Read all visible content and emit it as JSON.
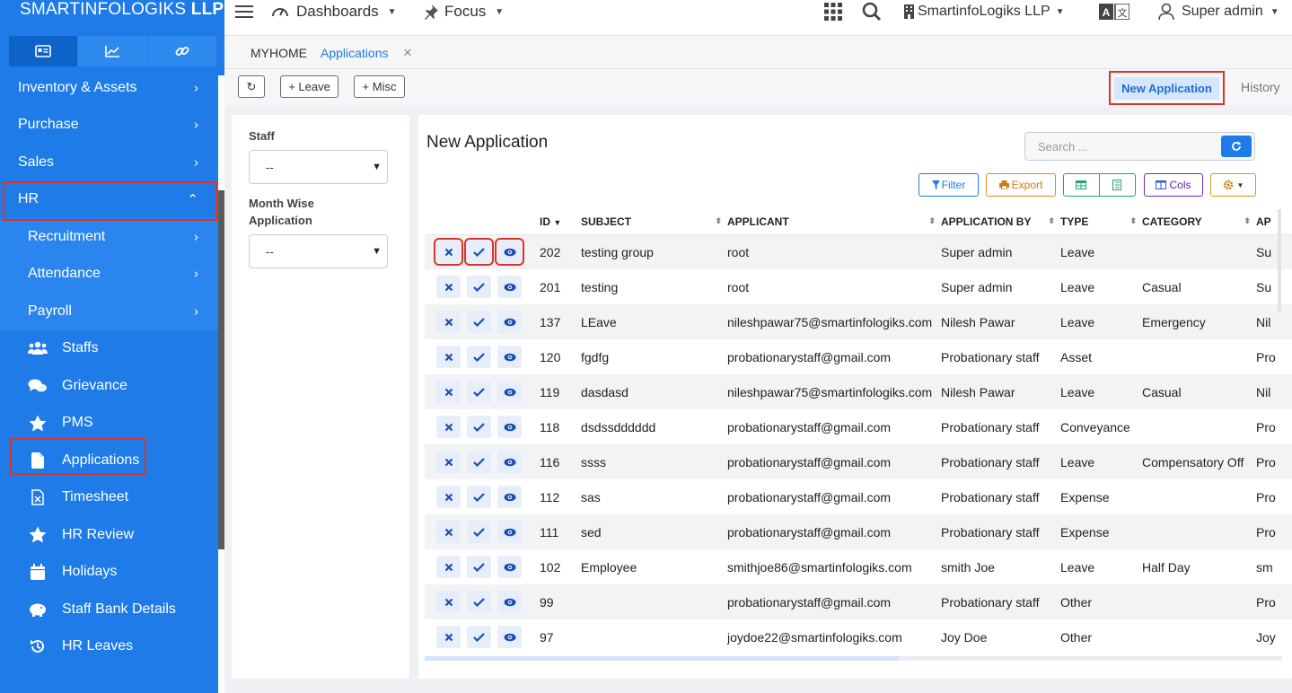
{
  "brand": {
    "name_light": "SMARTINFOLOGIKS",
    "name_bold": "LLP"
  },
  "sidebar": {
    "tabs": [
      {
        "icon": "id-card-icon"
      },
      {
        "icon": "chart-line-icon"
      },
      {
        "icon": "link-icon"
      }
    ],
    "items": [
      {
        "label": "Inventory & Assets",
        "level": 0,
        "chevron": "›"
      },
      {
        "label": "Purchase",
        "level": 0,
        "chevron": "›"
      },
      {
        "label": "Sales",
        "level": 0,
        "chevron": "›"
      },
      {
        "label": "HR",
        "level": 0,
        "chevron": "⌃"
      },
      {
        "label": "Recruitment",
        "level": 1,
        "chevron": "›"
      },
      {
        "label": "Attendance",
        "level": 1,
        "chevron": "›"
      },
      {
        "label": "Payroll",
        "level": 1,
        "chevron": "›"
      },
      {
        "label": "Staffs",
        "level": 2,
        "icon": "users-icon"
      },
      {
        "label": "Grievance",
        "level": 2,
        "icon": "comments-icon"
      },
      {
        "label": "PMS",
        "level": 2,
        "icon": "star-icon"
      },
      {
        "label": "Applications",
        "level": 2,
        "icon": "file-icon"
      },
      {
        "label": "Timesheet",
        "level": 2,
        "icon": "excel-file-icon"
      },
      {
        "label": "HR Review",
        "level": 2,
        "icon": "star-icon"
      },
      {
        "label": "Holidays",
        "level": 2,
        "icon": "calendar-icon"
      },
      {
        "label": "Staff Bank Details",
        "level": 2,
        "icon": "piggy-bank-icon"
      },
      {
        "label": "HR Leaves",
        "level": 2,
        "icon": "history-icon"
      }
    ]
  },
  "topbar": {
    "dashboards": "Dashboards",
    "focus": "Focus",
    "company": "SmartinfoLogiks LLP",
    "user": "Super admin"
  },
  "crumbs": {
    "home": "MYHOME",
    "current": "Applications",
    "close": "×"
  },
  "actions": {
    "refresh": "↻",
    "leave": "+ Leave",
    "misc": "+ Misc",
    "new_application": "New Application",
    "history": "History"
  },
  "filter": {
    "staff_label": "Staff",
    "staff_value": "--",
    "month_label_1": "Month Wise",
    "month_label_2": "Application",
    "month_value": "--"
  },
  "panel": {
    "title": "New Application",
    "search_placeholder": "Search ...",
    "filter_btn": "Filter",
    "export_btn": "Export",
    "cols_btn": "Cols"
  },
  "table": {
    "columns": [
      "ID",
      "SUBJECT",
      "APPLICANT",
      "APPLICATION BY",
      "TYPE",
      "CATEGORY",
      "AP"
    ],
    "rows": [
      {
        "id": "202",
        "subject": "testing group",
        "applicant": "root",
        "by": "Super admin",
        "type": "Leave",
        "category": "",
        "ap": "Su"
      },
      {
        "id": "201",
        "subject": "testing",
        "applicant": "root",
        "by": "Super admin",
        "type": "Leave",
        "category": "Casual",
        "ap": "Su"
      },
      {
        "id": "137",
        "subject": "LEave",
        "applicant": "nileshpawar75@smartinfologiks.com",
        "by": "Nilesh Pawar",
        "type": "Leave",
        "category": "Emergency",
        "ap": "Nil"
      },
      {
        "id": "120",
        "subject": "fgdfg",
        "applicant": "probationarystaff@gmail.com",
        "by": "Probationary staff",
        "type": "Asset",
        "category": "",
        "ap": "Pro"
      },
      {
        "id": "119",
        "subject": "dasdasd",
        "applicant": "nileshpawar75@smartinfologiks.com",
        "by": "Nilesh Pawar",
        "type": "Leave",
        "category": "Casual",
        "ap": "Nil"
      },
      {
        "id": "118",
        "subject": "dsdssdddddd",
        "applicant": "probationarystaff@gmail.com",
        "by": "Probationary staff",
        "type": "Conveyance",
        "category": "",
        "ap": "Pro"
      },
      {
        "id": "116",
        "subject": "ssss",
        "applicant": "probationarystaff@gmail.com",
        "by": "Probationary staff",
        "type": "Leave",
        "category": "Compensatory Off",
        "ap": "Pro"
      },
      {
        "id": "112",
        "subject": "sas",
        "applicant": "probationarystaff@gmail.com",
        "by": "Probationary staff",
        "type": "Expense",
        "category": "",
        "ap": "Pro"
      },
      {
        "id": "111",
        "subject": "sed",
        "applicant": "probationarystaff@gmail.com",
        "by": "Probationary staff",
        "type": "Expense",
        "category": "",
        "ap": "Pro"
      },
      {
        "id": "102",
        "subject": "Employee",
        "applicant": "smithjoe86@smartinfologiks.com",
        "by": "smith Joe",
        "type": "Leave",
        "category": "Half Day",
        "ap": "sm"
      },
      {
        "id": "99",
        "subject": "",
        "applicant": "probationarystaff@gmail.com",
        "by": "Probationary staff",
        "type": "Other",
        "category": "",
        "ap": "Pro"
      },
      {
        "id": "97",
        "subject": "",
        "applicant": "joydoe22@smartinfologiks.com",
        "by": "Joy Doe",
        "type": "Other",
        "category": "",
        "ap": "Joy"
      }
    ]
  }
}
